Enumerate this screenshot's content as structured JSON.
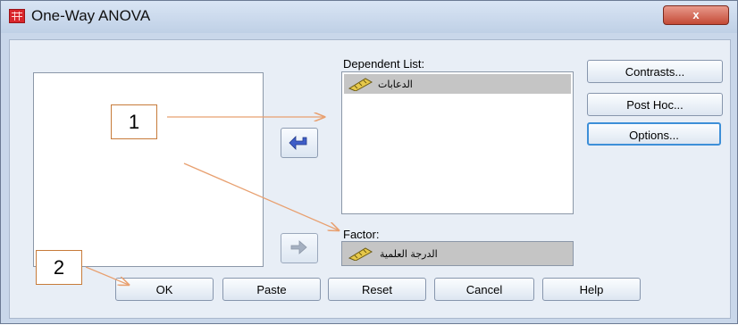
{
  "window": {
    "title": "One-Way ANOVA",
    "close_symbol": "x"
  },
  "dependent_list": {
    "label": "Dependent List:",
    "variable": "الدعابات"
  },
  "factor": {
    "label": "Factor:",
    "variable": "الدرجة العلمية"
  },
  "side_buttons": {
    "contrasts": "Contrasts...",
    "post_hoc": "Post Hoc...",
    "options": "Options..."
  },
  "bottom_buttons": {
    "ok": "OK",
    "paste": "Paste",
    "reset": "Reset",
    "cancel": "Cancel",
    "help": "Help"
  },
  "annotations": {
    "callout_1": "1",
    "callout_2": "2"
  },
  "colors": {
    "callout_border": "#c77b3a",
    "arrow": "#e8a070",
    "close_button": "#c44a36"
  },
  "icons": [
    "table-app-icon",
    "close-icon",
    "arrow-right-icon",
    "pencil-scale-icon"
  ]
}
